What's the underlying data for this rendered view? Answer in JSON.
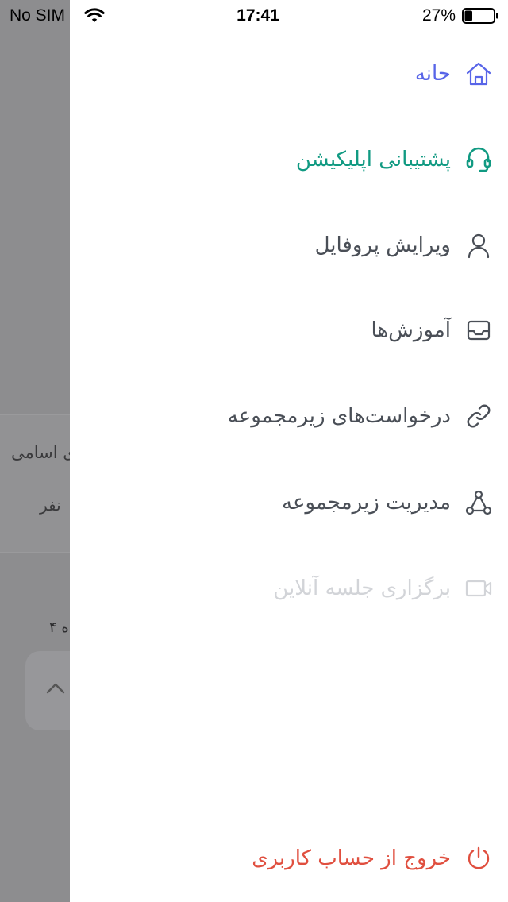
{
  "status_bar": {
    "carrier": "No SIM",
    "time": "17:41",
    "battery_percent": "27%",
    "battery_level": 0.27
  },
  "background_page": {
    "text_1": "ی اسامی",
    "text_2": "نفر",
    "text_3": "ه ۴"
  },
  "menu": {
    "items": [
      {
        "label": "حانه",
        "icon": "home-icon",
        "color": "#5865e8"
      },
      {
        "label": "پشتیبانی اپلیکیشن",
        "icon": "headset-icon",
        "color": "#119a82"
      },
      {
        "label": "ویرایش پروفایل",
        "icon": "user-icon",
        "color": "#4a4f57"
      },
      {
        "label": "آموزش‌ها",
        "icon": "inbox-icon",
        "color": "#4a4f57"
      },
      {
        "label": "درخواست‌های زیرمجموعه",
        "icon": "link-icon",
        "color": "#4a4f57"
      },
      {
        "label": "مدیریت زیرمجموعه",
        "icon": "share-nodes-icon",
        "color": "#4a4f57"
      },
      {
        "label": "برگزاری جلسه آنلاین",
        "icon": "video-camera-icon",
        "color": "#d2d4d8"
      }
    ],
    "logout": {
      "label": "خروج از حساب کاربری",
      "icon": "power-icon",
      "color": "#e04f3f"
    }
  }
}
